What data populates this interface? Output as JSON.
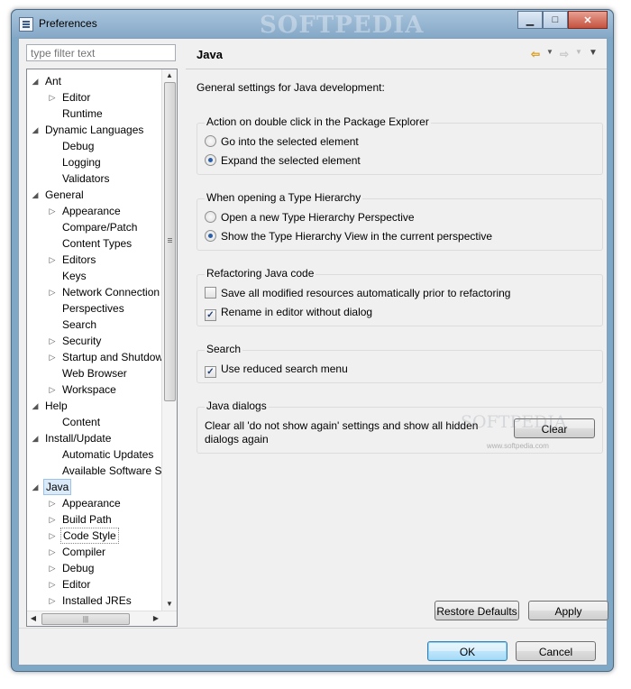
{
  "window": {
    "title": "Preferences",
    "watermark": "SOFTPEDIA",
    "caption_buttons": [
      "minimize",
      "maximize",
      "close"
    ]
  },
  "filter": {
    "placeholder": "type filter text",
    "value": ""
  },
  "tree": {
    "items": [
      {
        "label": "Ant",
        "level": 0,
        "expander": "expanded"
      },
      {
        "label": "Editor",
        "level": 1,
        "expander": "collapsed"
      },
      {
        "label": "Runtime",
        "level": 1,
        "expander": "none"
      },
      {
        "label": "Dynamic Languages",
        "level": 0,
        "expander": "expanded"
      },
      {
        "label": "Debug",
        "level": 1,
        "expander": "none"
      },
      {
        "label": "Logging",
        "level": 1,
        "expander": "none"
      },
      {
        "label": "Validators",
        "level": 1,
        "expander": "none"
      },
      {
        "label": "General",
        "level": 0,
        "expander": "expanded"
      },
      {
        "label": "Appearance",
        "level": 1,
        "expander": "collapsed"
      },
      {
        "label": "Compare/Patch",
        "level": 1,
        "expander": "none"
      },
      {
        "label": "Content Types",
        "level": 1,
        "expander": "none"
      },
      {
        "label": "Editors",
        "level": 1,
        "expander": "collapsed"
      },
      {
        "label": "Keys",
        "level": 1,
        "expander": "none"
      },
      {
        "label": "Network Connection",
        "level": 1,
        "expander": "collapsed"
      },
      {
        "label": "Perspectives",
        "level": 1,
        "expander": "none"
      },
      {
        "label": "Search",
        "level": 1,
        "expander": "none"
      },
      {
        "label": "Security",
        "level": 1,
        "expander": "collapsed"
      },
      {
        "label": "Startup and Shutdow",
        "level": 1,
        "expander": "collapsed"
      },
      {
        "label": "Web Browser",
        "level": 1,
        "expander": "none"
      },
      {
        "label": "Workspace",
        "level": 1,
        "expander": "collapsed"
      },
      {
        "label": "Help",
        "level": 0,
        "expander": "expanded"
      },
      {
        "label": "Content",
        "level": 1,
        "expander": "none"
      },
      {
        "label": "Install/Update",
        "level": 0,
        "expander": "expanded"
      },
      {
        "label": "Automatic Updates",
        "level": 1,
        "expander": "none"
      },
      {
        "label": "Available Software S",
        "level": 1,
        "expander": "none"
      },
      {
        "label": "Java",
        "level": 0,
        "expander": "expanded",
        "state": "selected"
      },
      {
        "label": "Appearance",
        "level": 1,
        "expander": "collapsed"
      },
      {
        "label": "Build Path",
        "level": 1,
        "expander": "collapsed"
      },
      {
        "label": "Code Style",
        "level": 1,
        "expander": "collapsed",
        "state": "focused"
      },
      {
        "label": "Compiler",
        "level": 1,
        "expander": "collapsed"
      },
      {
        "label": "Debug",
        "level": 1,
        "expander": "collapsed"
      },
      {
        "label": "Editor",
        "level": 1,
        "expander": "collapsed"
      },
      {
        "label": "Installed JREs",
        "level": 1,
        "expander": "collapsed"
      }
    ],
    "scroll_position": 0.0
  },
  "page": {
    "title": "Java",
    "description": "General settings for Java development:",
    "nav_icons": [
      "back-arrow-icon",
      "back-dropdown-icon",
      "forward-arrow-icon",
      "forward-dropdown-icon",
      "view-menu-icon"
    ]
  },
  "groups": {
    "double_click": {
      "title": "Action on double click in the Package Explorer",
      "options": [
        {
          "label": "Go into the selected element",
          "checked": false
        },
        {
          "label": "Expand the selected element",
          "checked": true
        }
      ]
    },
    "type_hierarchy": {
      "title": "When opening a Type Hierarchy",
      "options": [
        {
          "label": "Open a new Type Hierarchy Perspective",
          "checked": false
        },
        {
          "label": "Show the Type Hierarchy View in the current perspective",
          "checked": true
        }
      ]
    },
    "refactoring": {
      "title": "Refactoring Java code",
      "options": [
        {
          "label": "Save all modified resources automatically prior to refactoring",
          "checked": false
        },
        {
          "label": "Rename in editor without dialog",
          "checked": true
        }
      ]
    },
    "search": {
      "title": "Search",
      "options": [
        {
          "label": "Use reduced search menu",
          "checked": true
        }
      ]
    },
    "java_dialogs": {
      "title": "Java dialogs",
      "text_line1": "Clear all 'do not show again' settings and show all hidden",
      "text_line2": "dialogs again",
      "clear_label": "Clear"
    }
  },
  "watermarks": {
    "center": "SOFTPEDIA",
    "small": "www.softpedia.com"
  },
  "buttons": {
    "restore_defaults": "Restore Defaults",
    "apply": "Apply",
    "ok": "OK",
    "cancel": "Cancel"
  }
}
